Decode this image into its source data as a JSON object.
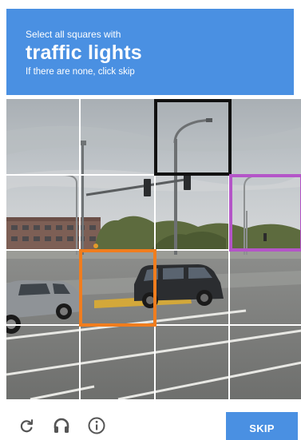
{
  "header": {
    "instruction": "Select all squares with",
    "target": "traffic lights",
    "hint": "If there are none, click skip"
  },
  "grid": {
    "rows": 4,
    "columns": 4,
    "highlighted_tiles": [
      {
        "row": 0,
        "column": 2,
        "color": "#111111"
      },
      {
        "row": 1,
        "column": 3,
        "color": "#b455c8"
      },
      {
        "row": 2,
        "column": 1,
        "color": "#f07d1e"
      }
    ]
  },
  "footer": {
    "reload_icon": "reload-icon",
    "audio_icon": "headphones-icon",
    "info_icon": "info-icon",
    "skip_label": "SKIP"
  },
  "colors": {
    "header_bg": "#4a90e2",
    "skip_bg": "#4a90e2",
    "icon_gray": "#555555"
  }
}
